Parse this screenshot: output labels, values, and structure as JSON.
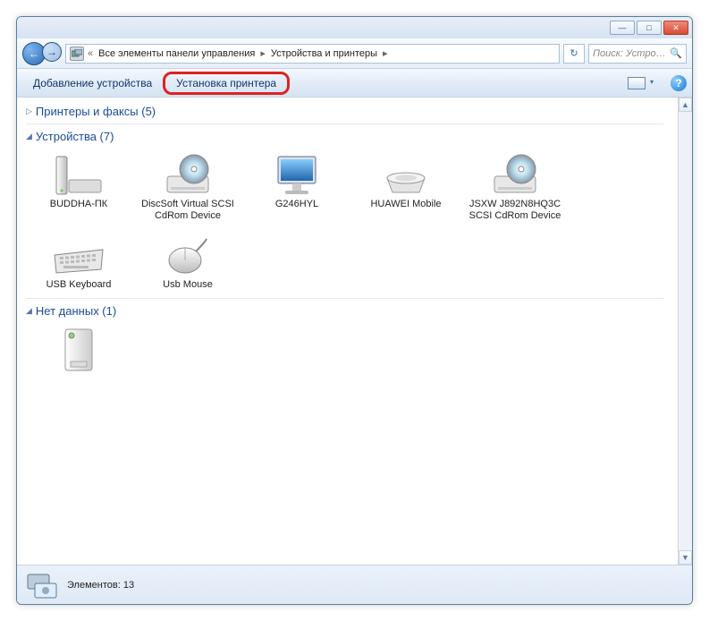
{
  "titlebar": {
    "min": "—",
    "max": "□",
    "close": "✕"
  },
  "nav": {
    "back": "←",
    "fwd": "→"
  },
  "breadcrumb": {
    "back_glyph": "«",
    "crumb1": "Все элементы панели управления",
    "crumb2": "Устройства и принтеры",
    "sep": "▸"
  },
  "refresh": "↻",
  "search": {
    "placeholder": "Поиск: Устро…",
    "icon": "🔍"
  },
  "toolbar": {
    "add_device": "Добавление устройства",
    "add_printer": "Установка принтера",
    "view_dropdown": "▾",
    "help": "?"
  },
  "groups": [
    {
      "title": "Принтеры и факсы (5)",
      "expanded": false,
      "items": []
    },
    {
      "title": "Устройства (7)",
      "expanded": true,
      "items": [
        {
          "name": "BUDDHA-ПК",
          "icon": "pc"
        },
        {
          "name": "DiscSoft Virtual SCSI CdRom Device",
          "icon": "cdrom"
        },
        {
          "name": "G246HYL",
          "icon": "monitor"
        },
        {
          "name": "HUAWEI Mobile",
          "icon": "disk"
        },
        {
          "name": "JSXW J892N8HQ3C SCSI CdRom Device",
          "icon": "cdrom"
        },
        {
          "name": "USB Keyboard",
          "icon": "keyboard"
        },
        {
          "name": "Usb Mouse",
          "icon": "mouse"
        }
      ]
    },
    {
      "title": "Нет данных (1)",
      "expanded": true,
      "items": [
        {
          "name": "",
          "icon": "drive"
        }
      ]
    }
  ],
  "status": {
    "label": "Элементов: 13"
  }
}
